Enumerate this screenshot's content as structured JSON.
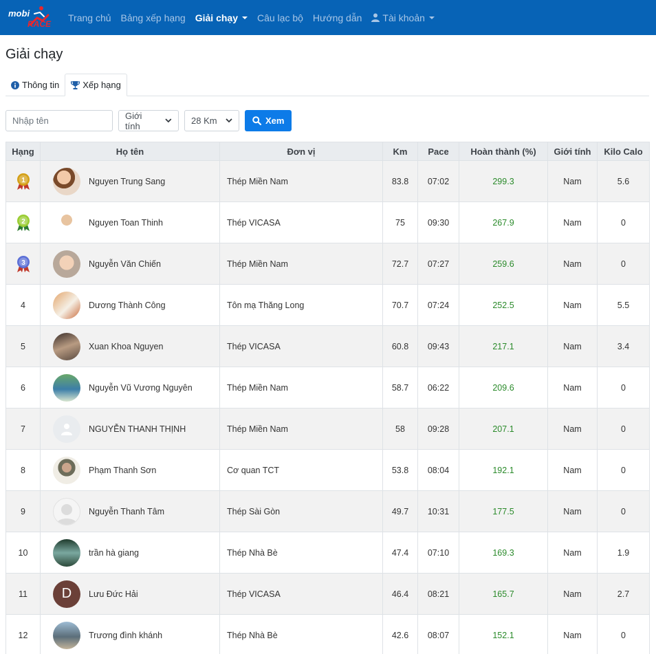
{
  "nav": {
    "brand_top": "mobi",
    "brand_bottom": "RACE",
    "items": [
      {
        "label": "Trang chủ"
      },
      {
        "label": "Bảng xếp hạng"
      },
      {
        "label": "Giải chạy"
      },
      {
        "label": "Câu lạc bộ"
      },
      {
        "label": "Hướng dẫn"
      },
      {
        "label": "Tài khoản"
      }
    ],
    "active_index": 2,
    "bg_color": "#0763b6"
  },
  "page": {
    "title": "Giải chạy"
  },
  "tabs": [
    {
      "label": "Thông tin",
      "icon": "info-icon"
    },
    {
      "label": "Xếp hạng",
      "icon": "trophy-icon",
      "active": true
    }
  ],
  "filters": {
    "name_placeholder": "Nhập tên",
    "gender_value": "Giới tính",
    "distance_value": "28 Km",
    "submit_label": "Xem"
  },
  "table": {
    "headers": [
      "Hạng",
      "Họ tên",
      "Đơn vị",
      "Km",
      "Pace",
      "Hoàn thành (%)",
      "Giới tính",
      "Kilo Calo"
    ],
    "rows": [
      {
        "rank": "1",
        "name": "Nguyen Trung Sang",
        "unit": "Thép Miền Nam",
        "km": "83.8",
        "pace": "07:02",
        "pct": "299.3",
        "gender": "Nam",
        "kcal": "5.6"
      },
      {
        "rank": "2",
        "name": "Nguyen Toan Thinh",
        "unit": "Thép VICASA",
        "km": "75",
        "pace": "09:30",
        "pct": "267.9",
        "gender": "Nam",
        "kcal": "0"
      },
      {
        "rank": "3",
        "name": "Nguyễn Văn Chiến",
        "unit": "Thép Miền Nam",
        "km": "72.7",
        "pace": "07:27",
        "pct": "259.6",
        "gender": "Nam",
        "kcal": "0"
      },
      {
        "rank": "4",
        "name": "Dương Thành Công",
        "unit": "Tôn mạ Thăng Long",
        "km": "70.7",
        "pace": "07:24",
        "pct": "252.5",
        "gender": "Nam",
        "kcal": "5.5"
      },
      {
        "rank": "5",
        "name": "Xuan Khoa Nguyen",
        "unit": "Thép VICASA",
        "km": "60.8",
        "pace": "09:43",
        "pct": "217.1",
        "gender": "Nam",
        "kcal": "3.4"
      },
      {
        "rank": "6",
        "name": "Nguyễn Vũ Vương Nguyên",
        "unit": "Thép Miền Nam",
        "km": "58.7",
        "pace": "06:22",
        "pct": "209.6",
        "gender": "Nam",
        "kcal": "0"
      },
      {
        "rank": "7",
        "name": "NGUYỄN THANH THỊNH",
        "unit": "Thép Miền Nam",
        "km": "58",
        "pace": "09:28",
        "pct": "207.1",
        "gender": "Nam",
        "kcal": "0"
      },
      {
        "rank": "8",
        "name": "Phạm Thanh Sơn",
        "unit": "Cơ quan TCT",
        "km": "53.8",
        "pace": "08:04",
        "pct": "192.1",
        "gender": "Nam",
        "kcal": "0"
      },
      {
        "rank": "9",
        "name": "Nguyễn Thanh Tâm",
        "unit": "Thép Sài Gòn",
        "km": "49.7",
        "pace": "10:31",
        "pct": "177.5",
        "gender": "Nam",
        "kcal": "0"
      },
      {
        "rank": "10",
        "name": "trần hà giang",
        "unit": "Thép Nhà Bè",
        "km": "47.4",
        "pace": "07:10",
        "pct": "169.3",
        "gender": "Nam",
        "kcal": "1.9"
      },
      {
        "rank": "11",
        "name": "Lưu Đức Hải",
        "unit": "Thép VICASA",
        "km": "46.4",
        "pace": "08:21",
        "pct": "165.7",
        "gender": "Nam",
        "kcal": "2.7"
      },
      {
        "rank": "12",
        "name": "Trương đình khánh",
        "unit": "Thép Nhà Bè",
        "km": "42.6",
        "pace": "08:07",
        "pct": "152.1",
        "gender": "Nam",
        "kcal": "0"
      }
    ]
  },
  "avatar_letter_row11": "D",
  "colors": {
    "completion": "#2a8a2a",
    "accent": "#0d7be8"
  }
}
